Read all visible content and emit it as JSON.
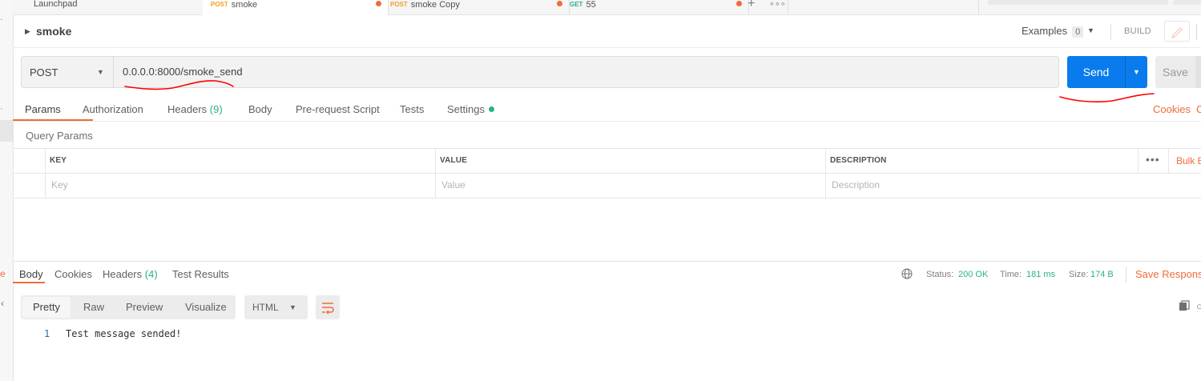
{
  "tabs": [
    {
      "method": "",
      "label": "Launchpad",
      "dirty": false,
      "active": false
    },
    {
      "method": "POST",
      "label": "smoke",
      "dirty": true,
      "active": true
    },
    {
      "method": "POST",
      "label": "smoke Copy",
      "dirty": true,
      "active": false
    },
    {
      "method": "GET",
      "label": "55",
      "dirty": true,
      "active": false
    }
  ],
  "tab_tools": {
    "add_icon": "plus-icon",
    "more_icon": "more-tabs-icon",
    "add_glyph": "+",
    "more_glyph": "∘∘∘"
  },
  "request": {
    "name": "smoke",
    "method": "POST",
    "url": "0.0.0.0:8000/smoke_send",
    "send_label": "Send",
    "save_label": "Save"
  },
  "header_right": {
    "examples_label": "Examples",
    "examples_count": "0",
    "build_label": "BUILD"
  },
  "request_tabs": {
    "params": "Params",
    "authorization": "Authorization",
    "headers": "Headers",
    "headers_count": "(9)",
    "body": "Body",
    "prerequest": "Pre-request Script",
    "tests": "Tests",
    "settings": "Settings",
    "cookies": "Cookies",
    "code": "C"
  },
  "query_params": {
    "title": "Query Params",
    "columns": [
      "KEY",
      "VALUE",
      "DESCRIPTION"
    ],
    "placeholders": [
      "Key",
      "Value",
      "Description"
    ],
    "more": "•••",
    "bulk_edit": "Bulk E"
  },
  "response": {
    "tabs": {
      "body": "Body",
      "cookies": "Cookies",
      "headers": "Headers",
      "headers_count": "(4)",
      "test_results": "Test Results"
    },
    "status_label": "Status:",
    "status_value": "200 OK",
    "time_label": "Time:",
    "time_value": "181 ms",
    "size_label": "Size:",
    "size_value": "174 B",
    "save_response": "Save Response",
    "formats": [
      "Pretty",
      "Raw",
      "Preview",
      "Visualize"
    ],
    "language": "HTML",
    "lines": [
      {
        "no": "1",
        "text": "Test message sended!"
      }
    ]
  },
  "colors": {
    "accent": "#f26b3a",
    "send_blue": "#097bed",
    "success_green": "#26b47f",
    "post_orange": "#f4a024",
    "annotation_red": "#ff0000"
  }
}
